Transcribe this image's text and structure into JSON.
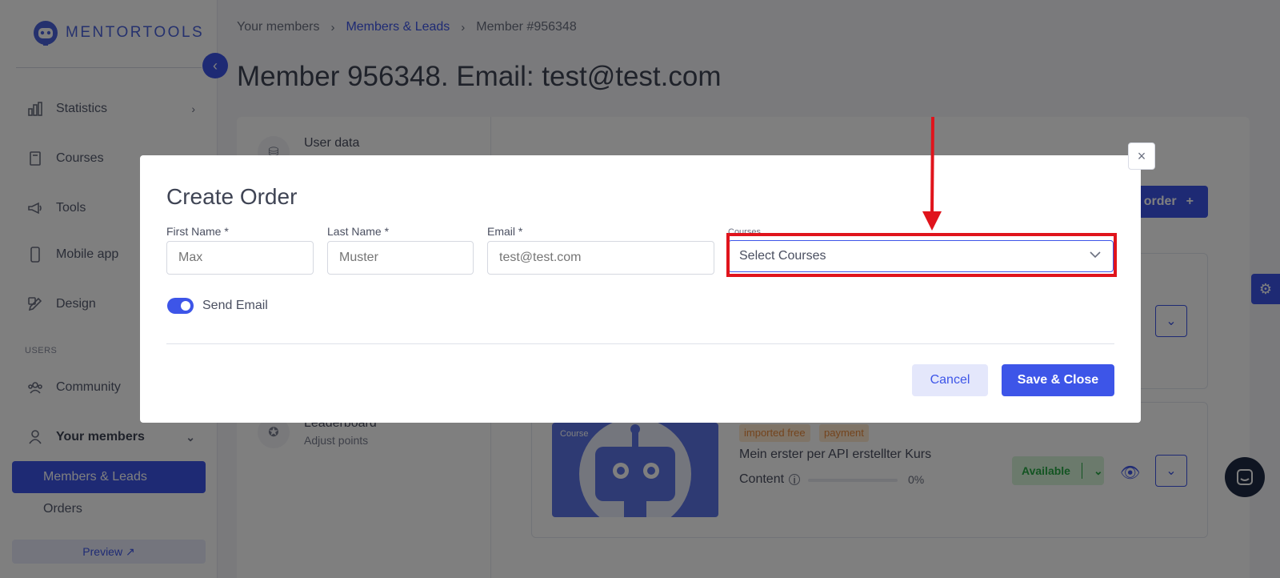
{
  "sidebar": {
    "brand": "MENTORTOOLS",
    "items": [
      {
        "label": "Statistics",
        "icon": "bar-chart-icon"
      },
      {
        "label": "Courses",
        "icon": "book-icon"
      },
      {
        "label": "Tools",
        "icon": "megaphone-icon"
      },
      {
        "label": "Mobile app",
        "icon": "phone-icon"
      },
      {
        "label": "Design",
        "icon": "pencil-icon"
      }
    ],
    "section_users": "USERS",
    "users_items": [
      {
        "label": "Community",
        "icon": "people-icon"
      },
      {
        "label": "Your members",
        "icon": "person-icon"
      }
    ],
    "sub_items": [
      "Members & Leads",
      "Orders"
    ],
    "preview_label": "Preview ↗"
  },
  "breadcrumb": [
    "Your members",
    "Members & Leads",
    "Member #956348"
  ],
  "page_title": "Member 956348. Email: test@test.com",
  "tabs": [
    {
      "title": "User data",
      "sub": ""
    },
    {
      "title": "Leaderboard",
      "sub": "Adjust points"
    }
  ],
  "add_order_label": "order",
  "course_card": {
    "thumb_label": "Course",
    "badges": [
      "imported free",
      "payment"
    ],
    "title": "Mein erster per API erstellter Kurs",
    "content_label": "Content",
    "progress": "0%",
    "status": "Available"
  },
  "modal": {
    "title": "Create Order",
    "fields": {
      "first_name": {
        "label": "First Name",
        "placeholder": "Max"
      },
      "last_name": {
        "label": "Last Name",
        "placeholder": "Muster"
      },
      "email": {
        "label": "Email",
        "placeholder": "test@test.com"
      },
      "courses": {
        "label": "Courses",
        "value": "Select Courses"
      }
    },
    "required_mark": "*",
    "send_email_label": "Send Email",
    "send_email_on": true,
    "cancel_label": "Cancel",
    "save_label": "Save & Close"
  },
  "colors": {
    "accent": "#3d55e8",
    "highlight": "#e0141c",
    "available_green": "#27a844"
  }
}
